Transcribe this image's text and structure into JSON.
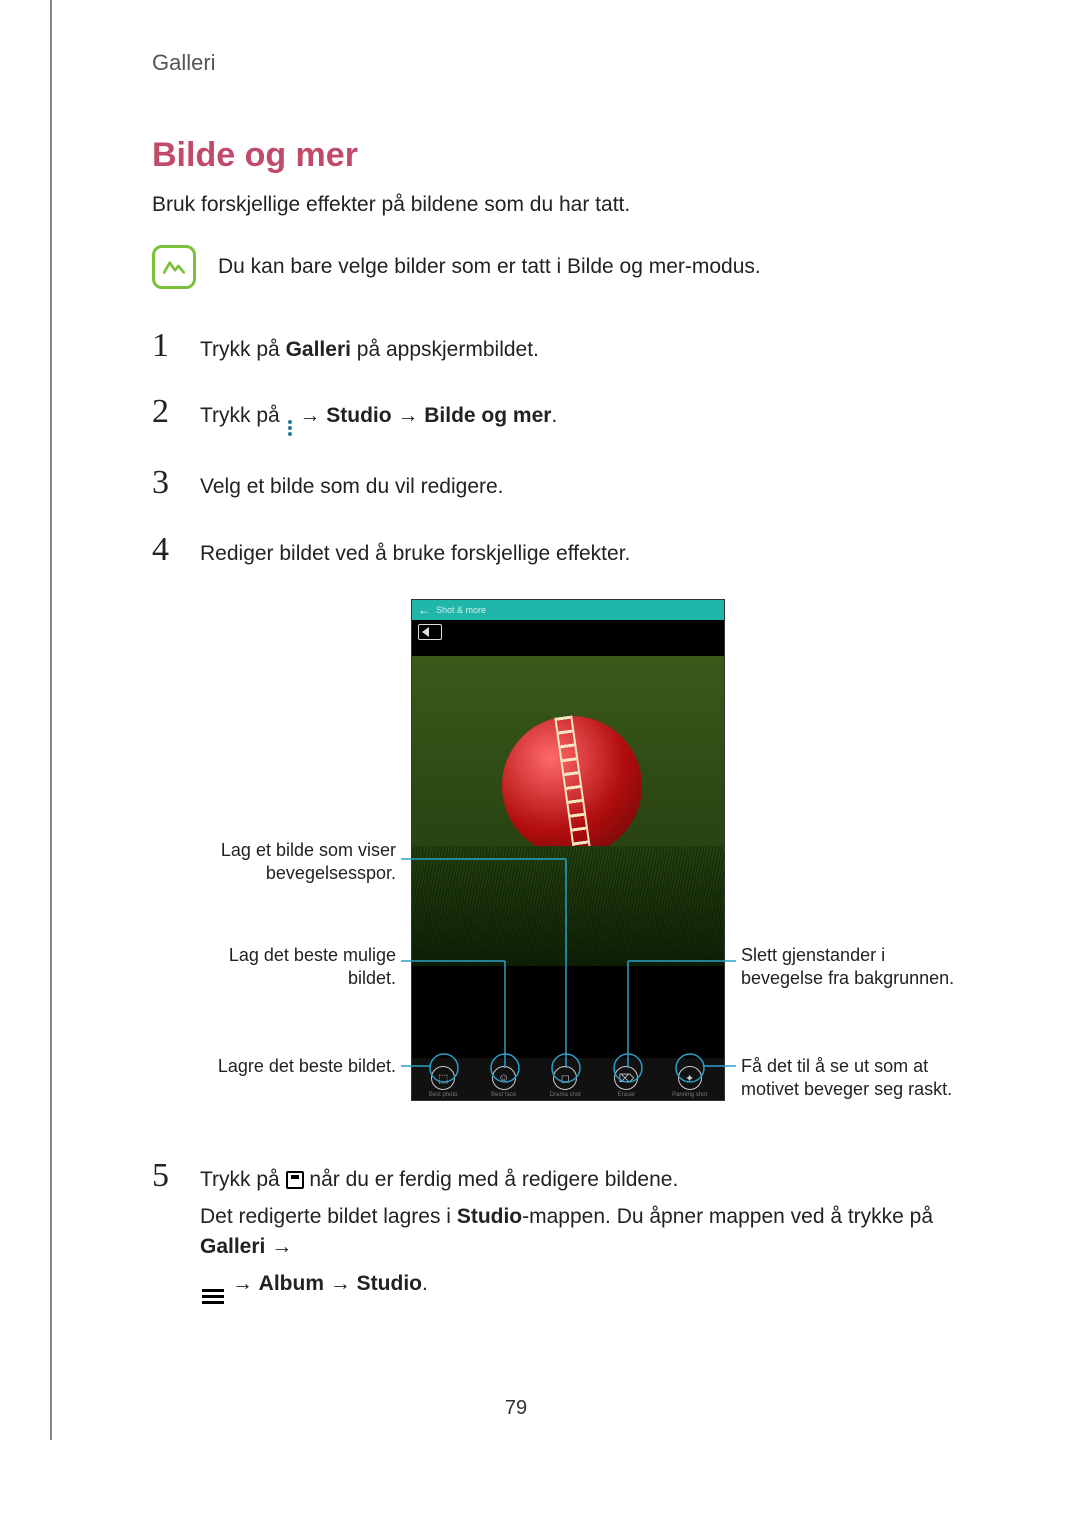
{
  "header": "Galleri",
  "section_title": "Bilde og mer",
  "intro": "Bruk forskjellige effekter på bildene som du har tatt.",
  "note": "Du kan bare velge bilder som er tatt i Bilde og mer-modus.",
  "steps": {
    "s1": {
      "num": "1",
      "pre": "Trykk på ",
      "b1": "Galleri",
      "post": " på appskjermbildet."
    },
    "s2": {
      "num": "2",
      "pre": "Trykk på ",
      "arrow": " → ",
      "b1": "Studio",
      "arrow2": " → ",
      "b2": "Bilde og mer",
      "post": "."
    },
    "s3": {
      "num": "3",
      "text": "Velg et bilde som du vil redigere."
    },
    "s4": {
      "num": "4",
      "text": "Rediger bildet ved å bruke forskjellige effekter."
    },
    "s5": {
      "num": "5",
      "line1_pre": "Trykk på ",
      "line1_post": " når du er ferdig med å redigere bildene.",
      "line2_a": "Det redigerte bildet lagres i ",
      "line2_b": "Studio",
      "line2_c": "-mappen. Du åpner mappen ved å trykke på ",
      "line2_d": "Galleri",
      "line2_e": " → ",
      "line3_arrow": " → ",
      "line3_b1": "Album",
      "line3_arrow2": " → ",
      "line3_b2": "Studio",
      "line3_post": "."
    }
  },
  "phone": {
    "back": "←",
    "header_title": "Shot & more",
    "tools": [
      {
        "glyph": "⬚",
        "label": "Best photo"
      },
      {
        "glyph": "☺",
        "label": "Best face"
      },
      {
        "glyph": "◻",
        "label": "Drama shot"
      },
      {
        "glyph": "⌦",
        "label": "Eraser"
      },
      {
        "glyph": "✦",
        "label": "Panning shot"
      }
    ]
  },
  "callouts": {
    "left1": "Lag et bilde som viser bevegelsesspor.",
    "left2": "Lag det beste mulige bildet.",
    "left3": "Lagre det beste bildet.",
    "right1": "Slett gjenstander i bevegelse fra bakgrunnen.",
    "right2": "Få det til å se ut som at motivet beveger seg raskt."
  },
  "page_number": "79"
}
